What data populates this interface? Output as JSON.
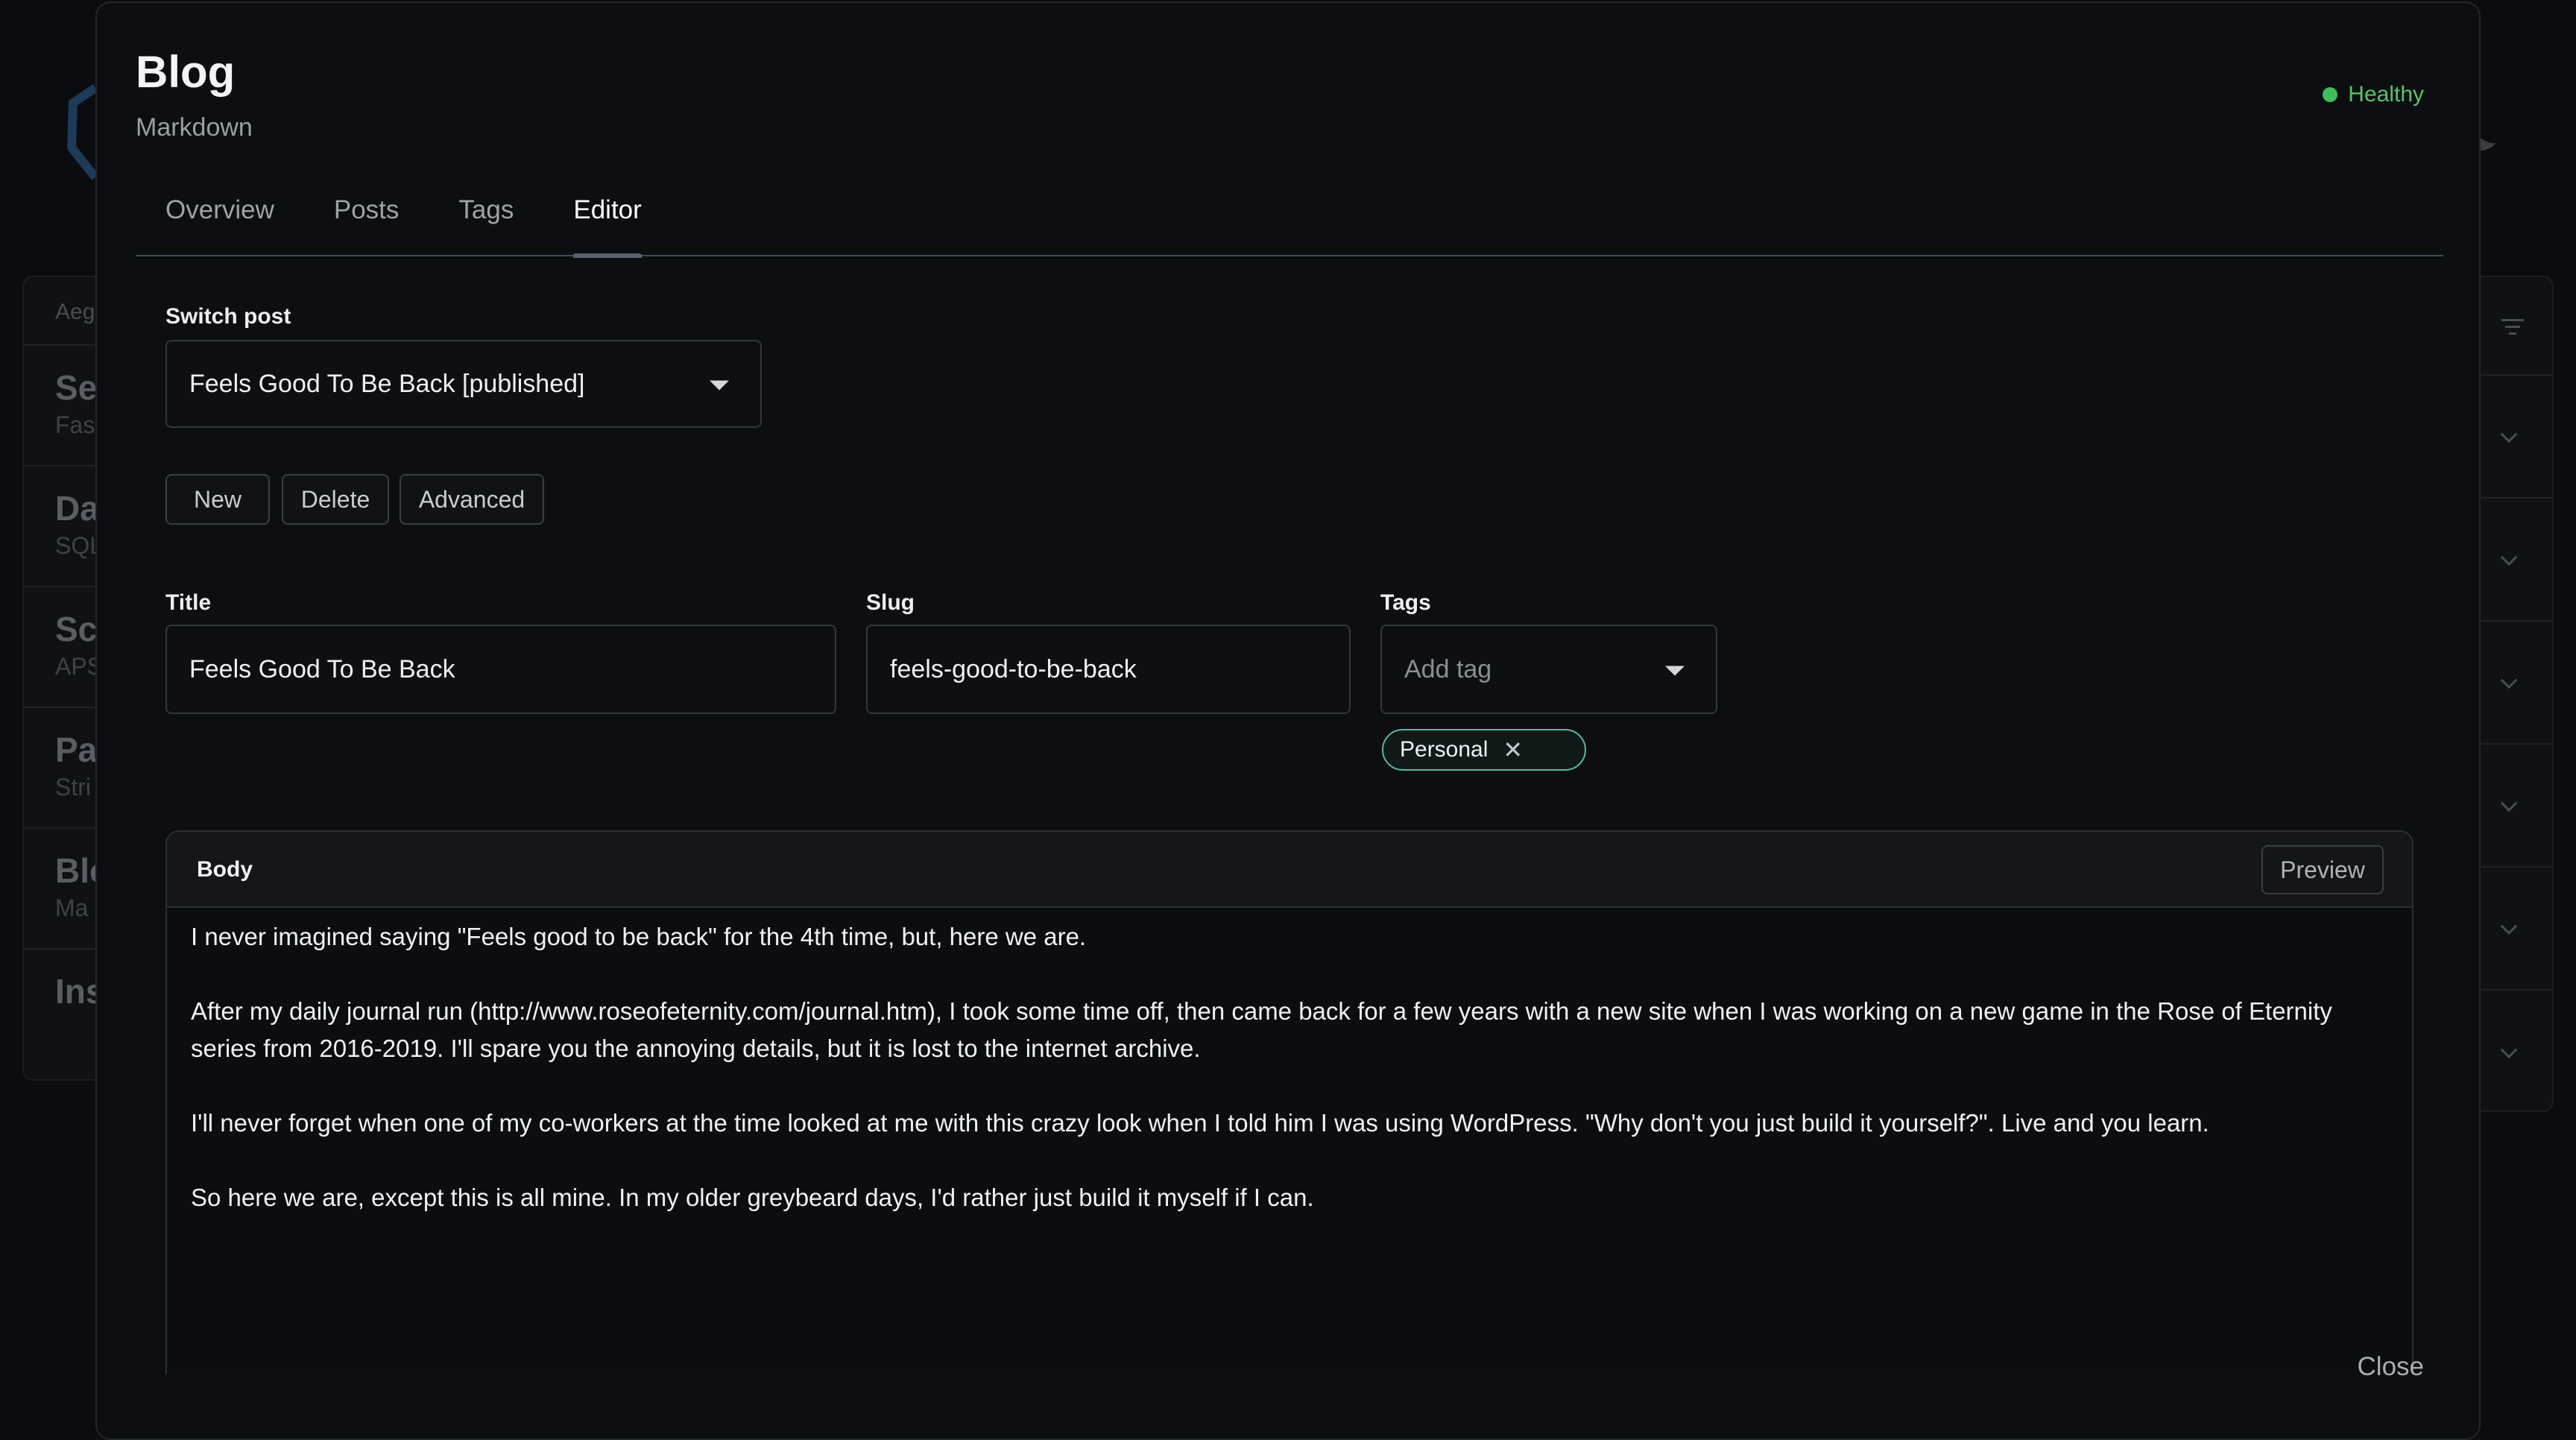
{
  "background": {
    "panel_header": "Aeg",
    "rows": [
      {
        "title": "Se",
        "subtitle": "Fas"
      },
      {
        "title": "Da",
        "subtitle": "SQL"
      },
      {
        "title": "Sc",
        "subtitle": "APS"
      },
      {
        "title": "Pa",
        "subtitle": "Stri"
      },
      {
        "title": "Blo",
        "subtitle": "Ma"
      },
      {
        "title": "Ins",
        "subtitle": ""
      }
    ]
  },
  "modal": {
    "title": "Blog",
    "subtitle": "Markdown",
    "status": "Healthy",
    "status_color": "#3fbf5c",
    "tabs": [
      {
        "label": "Overview"
      },
      {
        "label": "Posts"
      },
      {
        "label": "Tags"
      },
      {
        "label": "Editor",
        "active": true
      }
    ],
    "switch_post": {
      "label": "Switch post",
      "value": "Feels Good To Be Back [published]"
    },
    "actions": {
      "new": "New",
      "delete": "Delete",
      "advanced": "Advanced"
    },
    "form": {
      "title_label": "Title",
      "title_value": "Feels Good To Be Back",
      "slug_label": "Slug",
      "slug_value": "feels-good-to-be-back",
      "tags_label": "Tags",
      "tags_placeholder": "Add tag",
      "tags": [
        "Personal"
      ]
    },
    "body": {
      "label": "Body",
      "preview_label": "Preview",
      "paragraphs": [
        "I never imagined saying \"Feels good to be back\" for the 4th time, but, here we are.",
        "After my daily journal run (http://www.roseofeternity.com/journal.htm), I took some time off, then came back for a few years with a new site when I was working on a new game in the Rose of Eternity series from 2016-2019. I'll spare you the annoying details, but it is lost to the internet archive.",
        "I'll never forget when one of my co-workers at the time looked at me with this crazy look when I told him I was using WordPress. \"Why don't you just build it yourself?\". Live and you learn.",
        "So here we are, except this is all mine. In my older greybeard days, I'd rather just build it myself if I can."
      ]
    },
    "close_label": "Close"
  }
}
